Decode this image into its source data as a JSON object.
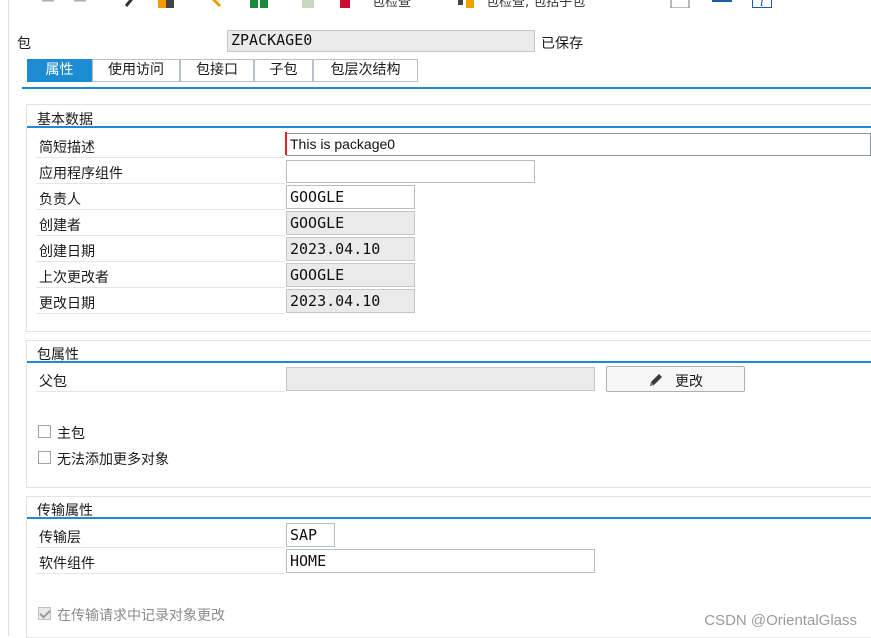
{
  "toolbar": {
    "items": [
      {
        "label": "包检查",
        "icon": "check-icon"
      },
      {
        "label": "包检查, 包括子包",
        "icon": "hierarchy-check-icon"
      }
    ]
  },
  "header": {
    "package_label": "包",
    "package_value": "ZPACKAGE0",
    "status": "已保存"
  },
  "tabs": [
    {
      "label": "属性",
      "active": true
    },
    {
      "label": "使用访问"
    },
    {
      "label": "包接口"
    },
    {
      "label": "子包"
    },
    {
      "label": "包层次结构"
    }
  ],
  "basic": {
    "title": "基本数据",
    "desc_label": "简短描述",
    "desc_value": "This is package0",
    "appcomp_label": "应用程序组件",
    "appcomp_value": "",
    "owner_label": "负责人",
    "owner_value": "GOOGLE",
    "creator_label": "创建者",
    "creator_value": "GOOGLE",
    "created_label": "创建日期",
    "created_value": "2023.04.10",
    "changer_label": "上次更改者",
    "changer_value": "GOOGLE",
    "changed_label": "更改日期",
    "changed_value": "2023.04.10"
  },
  "pkg": {
    "title": "包属性",
    "parent_label": "父包",
    "parent_value": "",
    "change_button": "更改",
    "main_package_label": "主包",
    "main_package_checked": false,
    "no_more_objects_label": "无法添加更多对象",
    "no_more_objects_checked": false
  },
  "transport": {
    "title": "传输属性",
    "layer_label": "传输层",
    "layer_value": "SAP",
    "swcomp_label": "软件组件",
    "swcomp_value": "HOME",
    "record_label": "在传输请求中记录对象更改",
    "record_checked": true
  },
  "watermark": "CSDN @OrientalGlass",
  "colors": {
    "accent": "#1c8bd2",
    "readonly": "#eaeaea"
  }
}
